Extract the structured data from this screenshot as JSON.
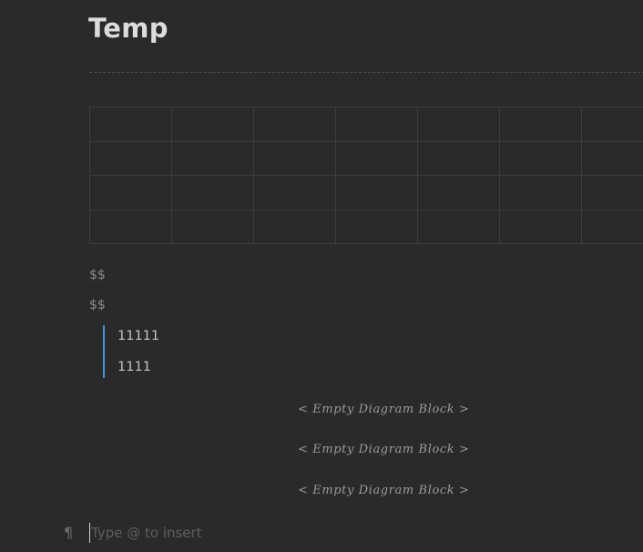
{
  "document": {
    "title": "Temp"
  },
  "table": {
    "rows": 4,
    "cols": 7
  },
  "math_blocks": [
    "$$",
    "$$"
  ],
  "blockquote": {
    "lines": [
      "11111",
      "1111"
    ]
  },
  "diagram_blocks": [
    "< Empty Diagram Block >",
    "< Empty Diagram Block >",
    "< Empty Diagram Block >"
  ],
  "editor": {
    "paragraph_icon": "¶",
    "input_value": "",
    "input_placeholder": "Type @ to insert"
  },
  "colors": {
    "background": "#2a2a2a",
    "quote_accent": "#4a8fd9"
  }
}
